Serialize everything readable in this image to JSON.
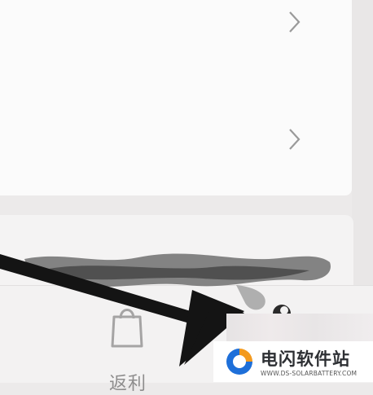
{
  "tab_bar": {
    "rebate_label": "返利",
    "rebate_icon": "shopping-bag-icon",
    "me_icon": "profile-icon"
  },
  "list": {
    "chevron_icon": "chevron-right-icon"
  },
  "watermark": {
    "title": "电闪软件站",
    "url": "WWW.DS-SOLARBATTERY.COM",
    "logo": "ds-logo"
  },
  "colors": {
    "background": "#eceaea",
    "card": "#fbfbfb",
    "label_gray": "#8e8d8d",
    "logo_orange": "#f39a1e",
    "logo_blue": "#1e6fd9",
    "arrow": "#141414"
  }
}
